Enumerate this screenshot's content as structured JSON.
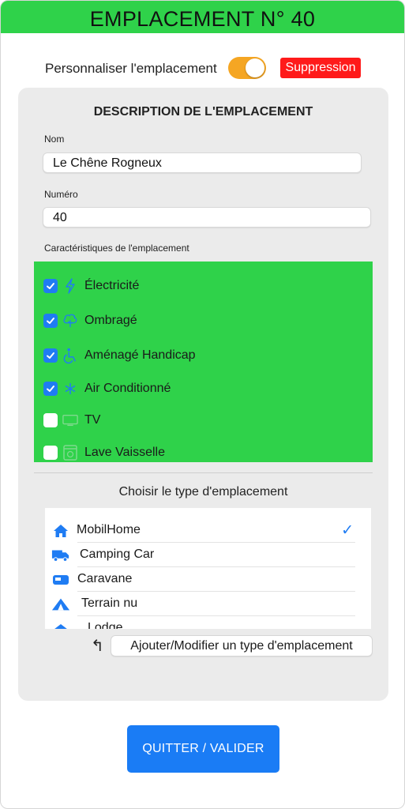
{
  "header": {
    "title": "EMPLACEMENT N° 40",
    "color": "#2fd24a"
  },
  "personalize": {
    "label": "Personnaliser l'emplacement",
    "toggle_on": true,
    "toggle_color": "#f5a623"
  },
  "delete_button": {
    "label": "Suppression",
    "color": "#ff1a1a"
  },
  "description": {
    "title": "DESCRIPTION DE L'EMPLACEMENT",
    "name_label": "Nom",
    "name_value": "Le Chêne Rogneux",
    "number_label": "Numéro",
    "number_value": "40",
    "features_label": "Caractéristiques de l'emplacement",
    "features": [
      {
        "label": "Électricité",
        "checked": true,
        "icon": "lightning-icon"
      },
      {
        "label": "Ombragé",
        "checked": true,
        "icon": "tree-icon"
      },
      {
        "label": "Aménagé Handicap",
        "checked": true,
        "icon": "wheelchair-icon"
      },
      {
        "label": "Air Conditionné",
        "checked": true,
        "icon": "snowflake-icon"
      },
      {
        "label": "TV",
        "checked": false,
        "icon": "tv-icon"
      },
      {
        "label": "Lave Vaisselle",
        "checked": false,
        "icon": "dishwasher-icon"
      }
    ]
  },
  "type_selection": {
    "title": "Choisir le type d'emplacement",
    "types": [
      {
        "label": "MobilHome",
        "icon": "house-icon",
        "selected": true
      },
      {
        "label": "Camping Car",
        "icon": "truck-icon",
        "selected": false
      },
      {
        "label": "Caravane",
        "icon": "caravan-icon",
        "selected": false
      },
      {
        "label": "Terrain nu",
        "icon": "tent-icon",
        "selected": false
      },
      {
        "label": "Lodge",
        "icon": "lodge-icon",
        "selected": false
      }
    ],
    "add_button": "Ajouter/Modifier un type d'emplacement"
  },
  "quit_button": {
    "label": "QUITTER / VALIDER",
    "color": "#1a7cf5"
  }
}
